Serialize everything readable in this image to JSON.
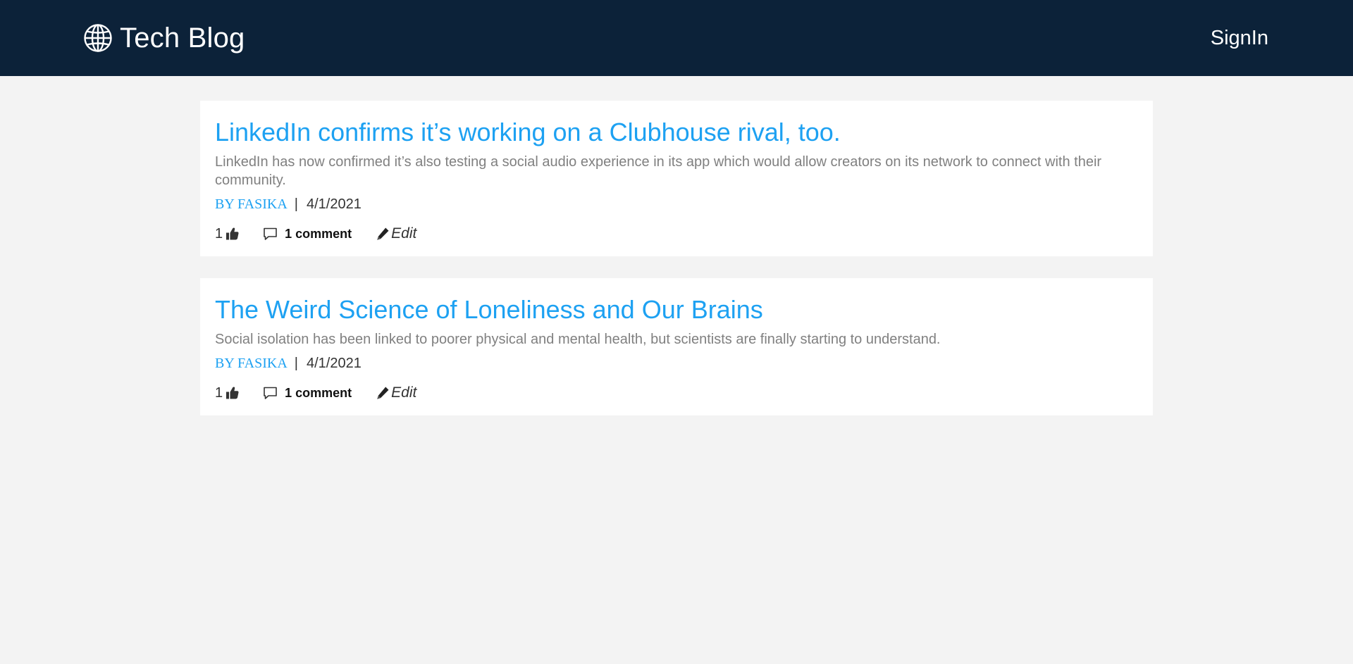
{
  "navbar": {
    "brand_icon": "globe-icon",
    "brand_title": "Tech Blog",
    "signin_label": "SignIn",
    "background": "#0c2239"
  },
  "theme": {
    "accent": "#1da1f2",
    "page_background": "#f3f3f3"
  },
  "posts": [
    {
      "title": "LinkedIn confirms it’s working on a Clubhouse rival, too.",
      "excerpt": "LinkedIn has now confirmed it’s also testing a social audio experience in its app which would allow creators on its network to connect with their community.",
      "author": "BY FASIKA",
      "separator": "|",
      "date": "4/1/2021",
      "likes": "1",
      "comments": "1 comment",
      "edit_label": "Edit"
    },
    {
      "title": "The Weird Science of Loneliness and Our Brains",
      "excerpt": "Social isolation has been linked to poorer physical and mental health, but scientists are finally starting to understand.",
      "author": "BY FASIKA",
      "separator": "|",
      "date": "4/1/2021",
      "likes": "1",
      "comments": "1 comment",
      "edit_label": "Edit"
    }
  ]
}
